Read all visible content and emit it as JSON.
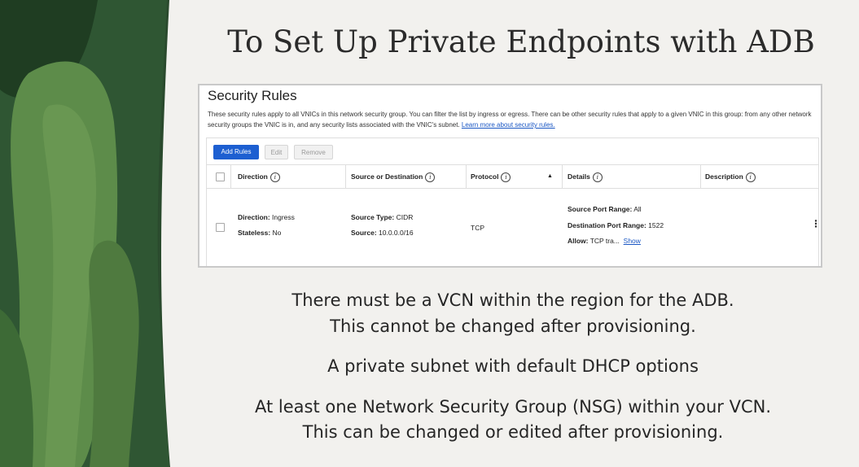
{
  "slide": {
    "title": "To Set Up Private Endpoints with ADB"
  },
  "security_rules": {
    "title": "Security Rules",
    "description": "These security rules apply to all VNICs in this network security group. You can filter the list by ingress or egress. There can be other security rules that apply to a given VNIC in this group: from any other network security groups the VNIC is in, and any security lists associated with the VNIC's subnet.",
    "learn_more": "Learn more about security rules.",
    "buttons": {
      "add": "Add Rules",
      "edit": "Edit",
      "remove": "Remove"
    },
    "columns": {
      "direction": "Direction",
      "source": "Source or Destination",
      "protocol": "Protocol",
      "details": "Details",
      "description": "Description"
    },
    "row": {
      "direction_label": "Direction:",
      "direction_value": " Ingress",
      "stateless_label": "Stateless:",
      "stateless_value": " No",
      "source_type_label": "Source Type:",
      "source_type_value": " CIDR",
      "source_label": "Source:",
      "source_value": " 10.0.0.0/16",
      "protocol": "TCP",
      "src_port_label": "Source Port Range:",
      "src_port_value": " All",
      "dst_port_label": "Destination Port Range:",
      "dst_port_value": " 1522",
      "allow_label": "Allow:",
      "allow_value": " TCP tra...",
      "show_link": "Show"
    }
  },
  "bullets": {
    "b1_line1": "There must be a VCN within the region for the ADB.",
    "b1_line2": "This cannot be changed after provisioning.",
    "b2": "A private subnet with default DHCP options",
    "b3_line1": "At least one Network Security Group (NSG) within your VCN.",
    "b3_line2": "This can be changed or edited after provisioning."
  }
}
